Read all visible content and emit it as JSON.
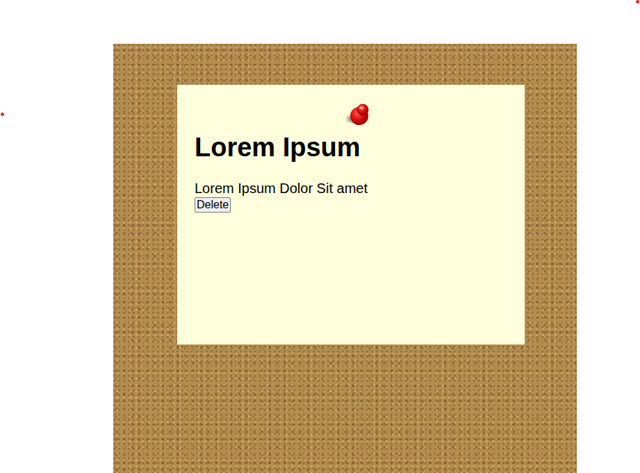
{
  "note": {
    "title": "Lorem Ipsum",
    "body": "Lorem Ipsum Dolor Sit amet",
    "button": "Delete"
  }
}
